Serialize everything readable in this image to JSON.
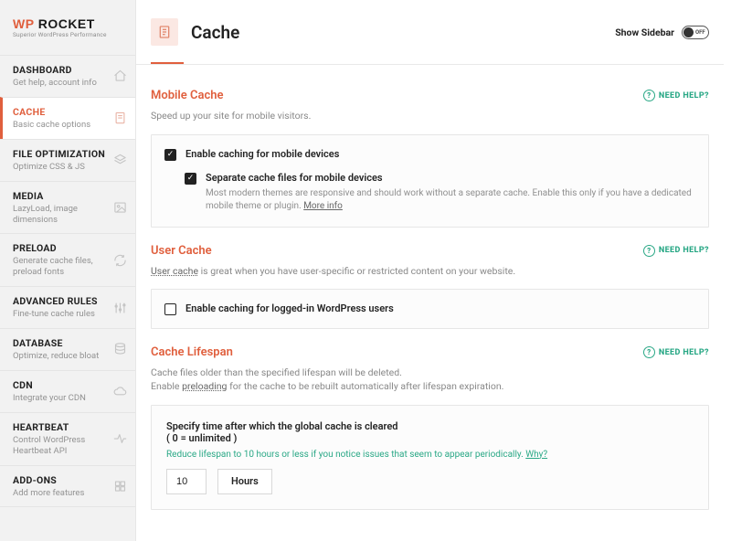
{
  "brand": {
    "name_prefix": "WP",
    "name_rest": " ROCKET",
    "tagline": "Superior WordPress Performance"
  },
  "header": {
    "title": "Cache",
    "show_sidebar_label": "Show Sidebar",
    "toggle_state_label": "OFF"
  },
  "help": {
    "need_help_label": "NEED HELP?"
  },
  "sidebar": {
    "items": [
      {
        "title": "DASHBOARD",
        "desc": "Get help, account info",
        "icon": "home-icon"
      },
      {
        "title": "CACHE",
        "desc": "Basic cache options",
        "icon": "document-icon",
        "active": true
      },
      {
        "title": "FILE OPTIMIZATION",
        "desc": "Optimize CSS & JS",
        "icon": "stack-icon"
      },
      {
        "title": "MEDIA",
        "desc": "LazyLoad, image dimensions",
        "icon": "image-icon"
      },
      {
        "title": "PRELOAD",
        "desc": "Generate cache files, preload fonts",
        "icon": "refresh-icon"
      },
      {
        "title": "ADVANCED RULES",
        "desc": "Fine-tune cache rules",
        "icon": "sliders-icon"
      },
      {
        "title": "DATABASE",
        "desc": "Optimize, reduce bloat",
        "icon": "database-icon"
      },
      {
        "title": "CDN",
        "desc": "Integrate your CDN",
        "icon": "cloud-icon"
      },
      {
        "title": "HEARTBEAT",
        "desc": "Control WordPress Heartbeat API",
        "icon": "heartbeat-icon"
      },
      {
        "title": "ADD-ONS",
        "desc": "Add more features",
        "icon": "puzzle-icon"
      }
    ]
  },
  "sections": {
    "mobile": {
      "title": "Mobile Cache",
      "intro": "Speed up your site for mobile visitors.",
      "opt1_label": "Enable caching for mobile devices",
      "opt1_checked": true,
      "opt2_label": "Separate cache files for mobile devices",
      "opt2_checked": true,
      "opt2_desc": "Most modern themes are responsive and should work without a separate cache. Enable this only if you have a dedicated mobile theme or plugin.",
      "more_info": "More info"
    },
    "user": {
      "title": "User Cache",
      "intro_linked": "User cache",
      "intro_rest": " is great when you have user-specific or restricted content on your website.",
      "opt_label": "Enable caching for logged-in WordPress users",
      "opt_checked": false
    },
    "lifespan": {
      "title": "Cache Lifespan",
      "intro_line1": "Cache files older than the specified lifespan will be deleted.",
      "intro_line2a": "Enable ",
      "intro_line2_link": "preloading",
      "intro_line2b": " for the cache to be rebuilt automatically after lifespan expiration.",
      "card_title": "Specify time after which the global cache is cleared",
      "card_sub": "( 0 = unlimited )",
      "tip": "Reduce lifespan to 10 hours or less if you notice issues that seem to appear periodically.",
      "tip_why": "Why?",
      "value": "10",
      "unit": "Hours"
    }
  }
}
